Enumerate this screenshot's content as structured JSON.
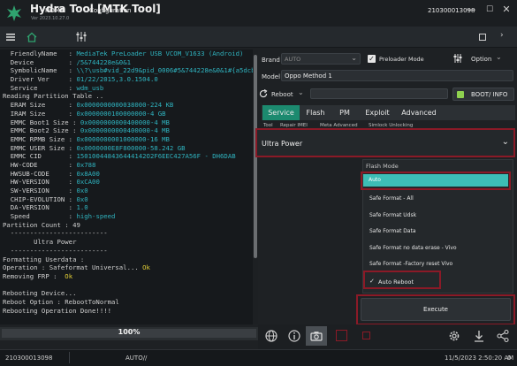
{
  "app": {
    "title": "Hydra Tool [MTK Tool]",
    "version": "Ver 2023.10.27.0"
  },
  "window": {
    "minimize": "—",
    "maximize": "☐",
    "close": "✕"
  },
  "nav": {
    "home": "HOME",
    "configuration": "Configuration",
    "device_id": "210300013098"
  },
  "console_lines": [
    [
      [
        "k",
        "  FriendlyName   : "
      ],
      [
        "v",
        "MediaTek PreLoader USB VCOM_V1633 (Android)"
      ]
    ],
    [
      [
        "k",
        "  Device         : "
      ],
      [
        "v",
        "/5&744228e&0&1"
      ]
    ],
    [
      [
        "k",
        "  SymbolicName   : "
      ],
      [
        "v",
        "\\\\?\\usb#vid_22d9&pid_0006#5&744228e&0&1#{a5dcbf10-6530-11d2}"
      ]
    ],
    [
      [
        "k",
        "  Driver Ver     : "
      ],
      [
        "v",
        "01/22/2015,3.0.1504.0"
      ]
    ],
    [
      [
        "k",
        "  Service        : "
      ],
      [
        "v",
        "wdm_usb"
      ]
    ],
    [
      [
        "k",
        "Reading Partition Table .."
      ]
    ],
    [
      [
        "k",
        "  ERAM Size      : "
      ],
      [
        "v",
        "0x0000000000038000-224 KB"
      ]
    ],
    [
      [
        "k",
        "  IRAM Size      : "
      ],
      [
        "v",
        "0x0000000100000000-4 GB"
      ]
    ],
    [
      [
        "k",
        "  EMMC Boot1 Size : "
      ],
      [
        "v",
        "0x0000000000400000-4 MB"
      ]
    ],
    [
      [
        "k",
        "  EMMC Boot2 Size : "
      ],
      [
        "v",
        "0x0000000000400000-4 MB"
      ]
    ],
    [
      [
        "k",
        "  EMMC RPMB Size : "
      ],
      [
        "v",
        "0x0000000001000000-16 MB"
      ]
    ],
    [
      [
        "k",
        "  EMMC USER Size : "
      ],
      [
        "v",
        "0x0000000E8F800000-58.242 GB"
      ]
    ],
    [
      [
        "k",
        "  EMMC CID       : "
      ],
      [
        "v",
        "150100448436444142O2F6EEC427A56F - DH6DAB"
      ]
    ],
    [
      [
        "k",
        "  HW-CODE        : "
      ],
      [
        "v",
        "0x788"
      ]
    ],
    [
      [
        "k",
        "  HWSUB-CODE     : "
      ],
      [
        "v",
        "0x8A00"
      ]
    ],
    [
      [
        "k",
        "  HW-VERSION     : "
      ],
      [
        "v",
        "0xCA00"
      ]
    ],
    [
      [
        "k",
        "  SW-VERSION     : "
      ],
      [
        "v",
        "0x0"
      ]
    ],
    [
      [
        "k",
        "  CHIP-EVOLUTION : "
      ],
      [
        "v",
        "0x0"
      ]
    ],
    [
      [
        "k",
        "  DA-VERSION     : "
      ],
      [
        "v",
        "1.0"
      ]
    ],
    [
      [
        "k",
        "  Speed          : "
      ],
      [
        "v",
        "high-speed"
      ]
    ],
    [
      [
        "k",
        "Partition Count : 49"
      ]
    ],
    [
      [
        "k",
        "  -------------------------"
      ]
    ],
    [
      [
        "k",
        "        Ultra Power"
      ]
    ],
    [
      [
        "k",
        "  -------------------------"
      ]
    ],
    [
      [
        "k",
        "Formatting Userdata :"
      ]
    ],
    [
      [
        "k",
        "Operation : Safeformat Universal... "
      ],
      [
        "y",
        "Ok"
      ]
    ],
    [
      [
        "k",
        "Removing FRP :  "
      ],
      [
        "y",
        "Ok"
      ]
    ],
    [
      [
        "k",
        " "
      ]
    ],
    [
      [
        "k",
        "Rebooting Device..."
      ]
    ],
    [
      [
        "k",
        "Reboot Option : RebootToNormal"
      ]
    ],
    [
      [
        "k",
        "Rebooting Operation Done!!!!"
      ]
    ]
  ],
  "progress": {
    "label": "100%",
    "value": 1.0
  },
  "brand": {
    "label": "Brand :",
    "value": "AUTO"
  },
  "preloader": {
    "label": "Preloader Mode",
    "checked": true
  },
  "option_label": "Option",
  "model": {
    "label": "Model :",
    "value": "Oppo Method 1"
  },
  "reboot_label": "Reboot",
  "boot_info_label": "BOOT/ INFO",
  "tabs": [
    "Service",
    "Flash",
    "PM",
    "Exploit",
    "Advanced"
  ],
  "subtabs": [
    "Tool",
    "Repair IMEI",
    "Meta Advanced",
    "Simlock Unlocking"
  ],
  "ultra_power": "Ultra Power",
  "flash_mode_label": "Flash Mode",
  "flash_modes": [
    "Auto",
    "Safe Format - All",
    "Safe Format Udsk",
    "Safe Format Data",
    "Safe Format no data erase - Vivo",
    "Safe Format -Factory reset Vivo"
  ],
  "auto_reboot": {
    "label": "Auto Reboot",
    "checked": true
  },
  "execute_label": "Execute",
  "status": {
    "serial": "210300013098",
    "mode": "AUTO//",
    "datetime": "11/5/2023 2:50:20 AM",
    "zero": "0"
  },
  "colors": {
    "accent": "#1c8a6f",
    "highlight": "#3dbdb6",
    "frame": "#8b1a27",
    "console_value": "#2fb3bf",
    "ok": "#e3cf36"
  }
}
